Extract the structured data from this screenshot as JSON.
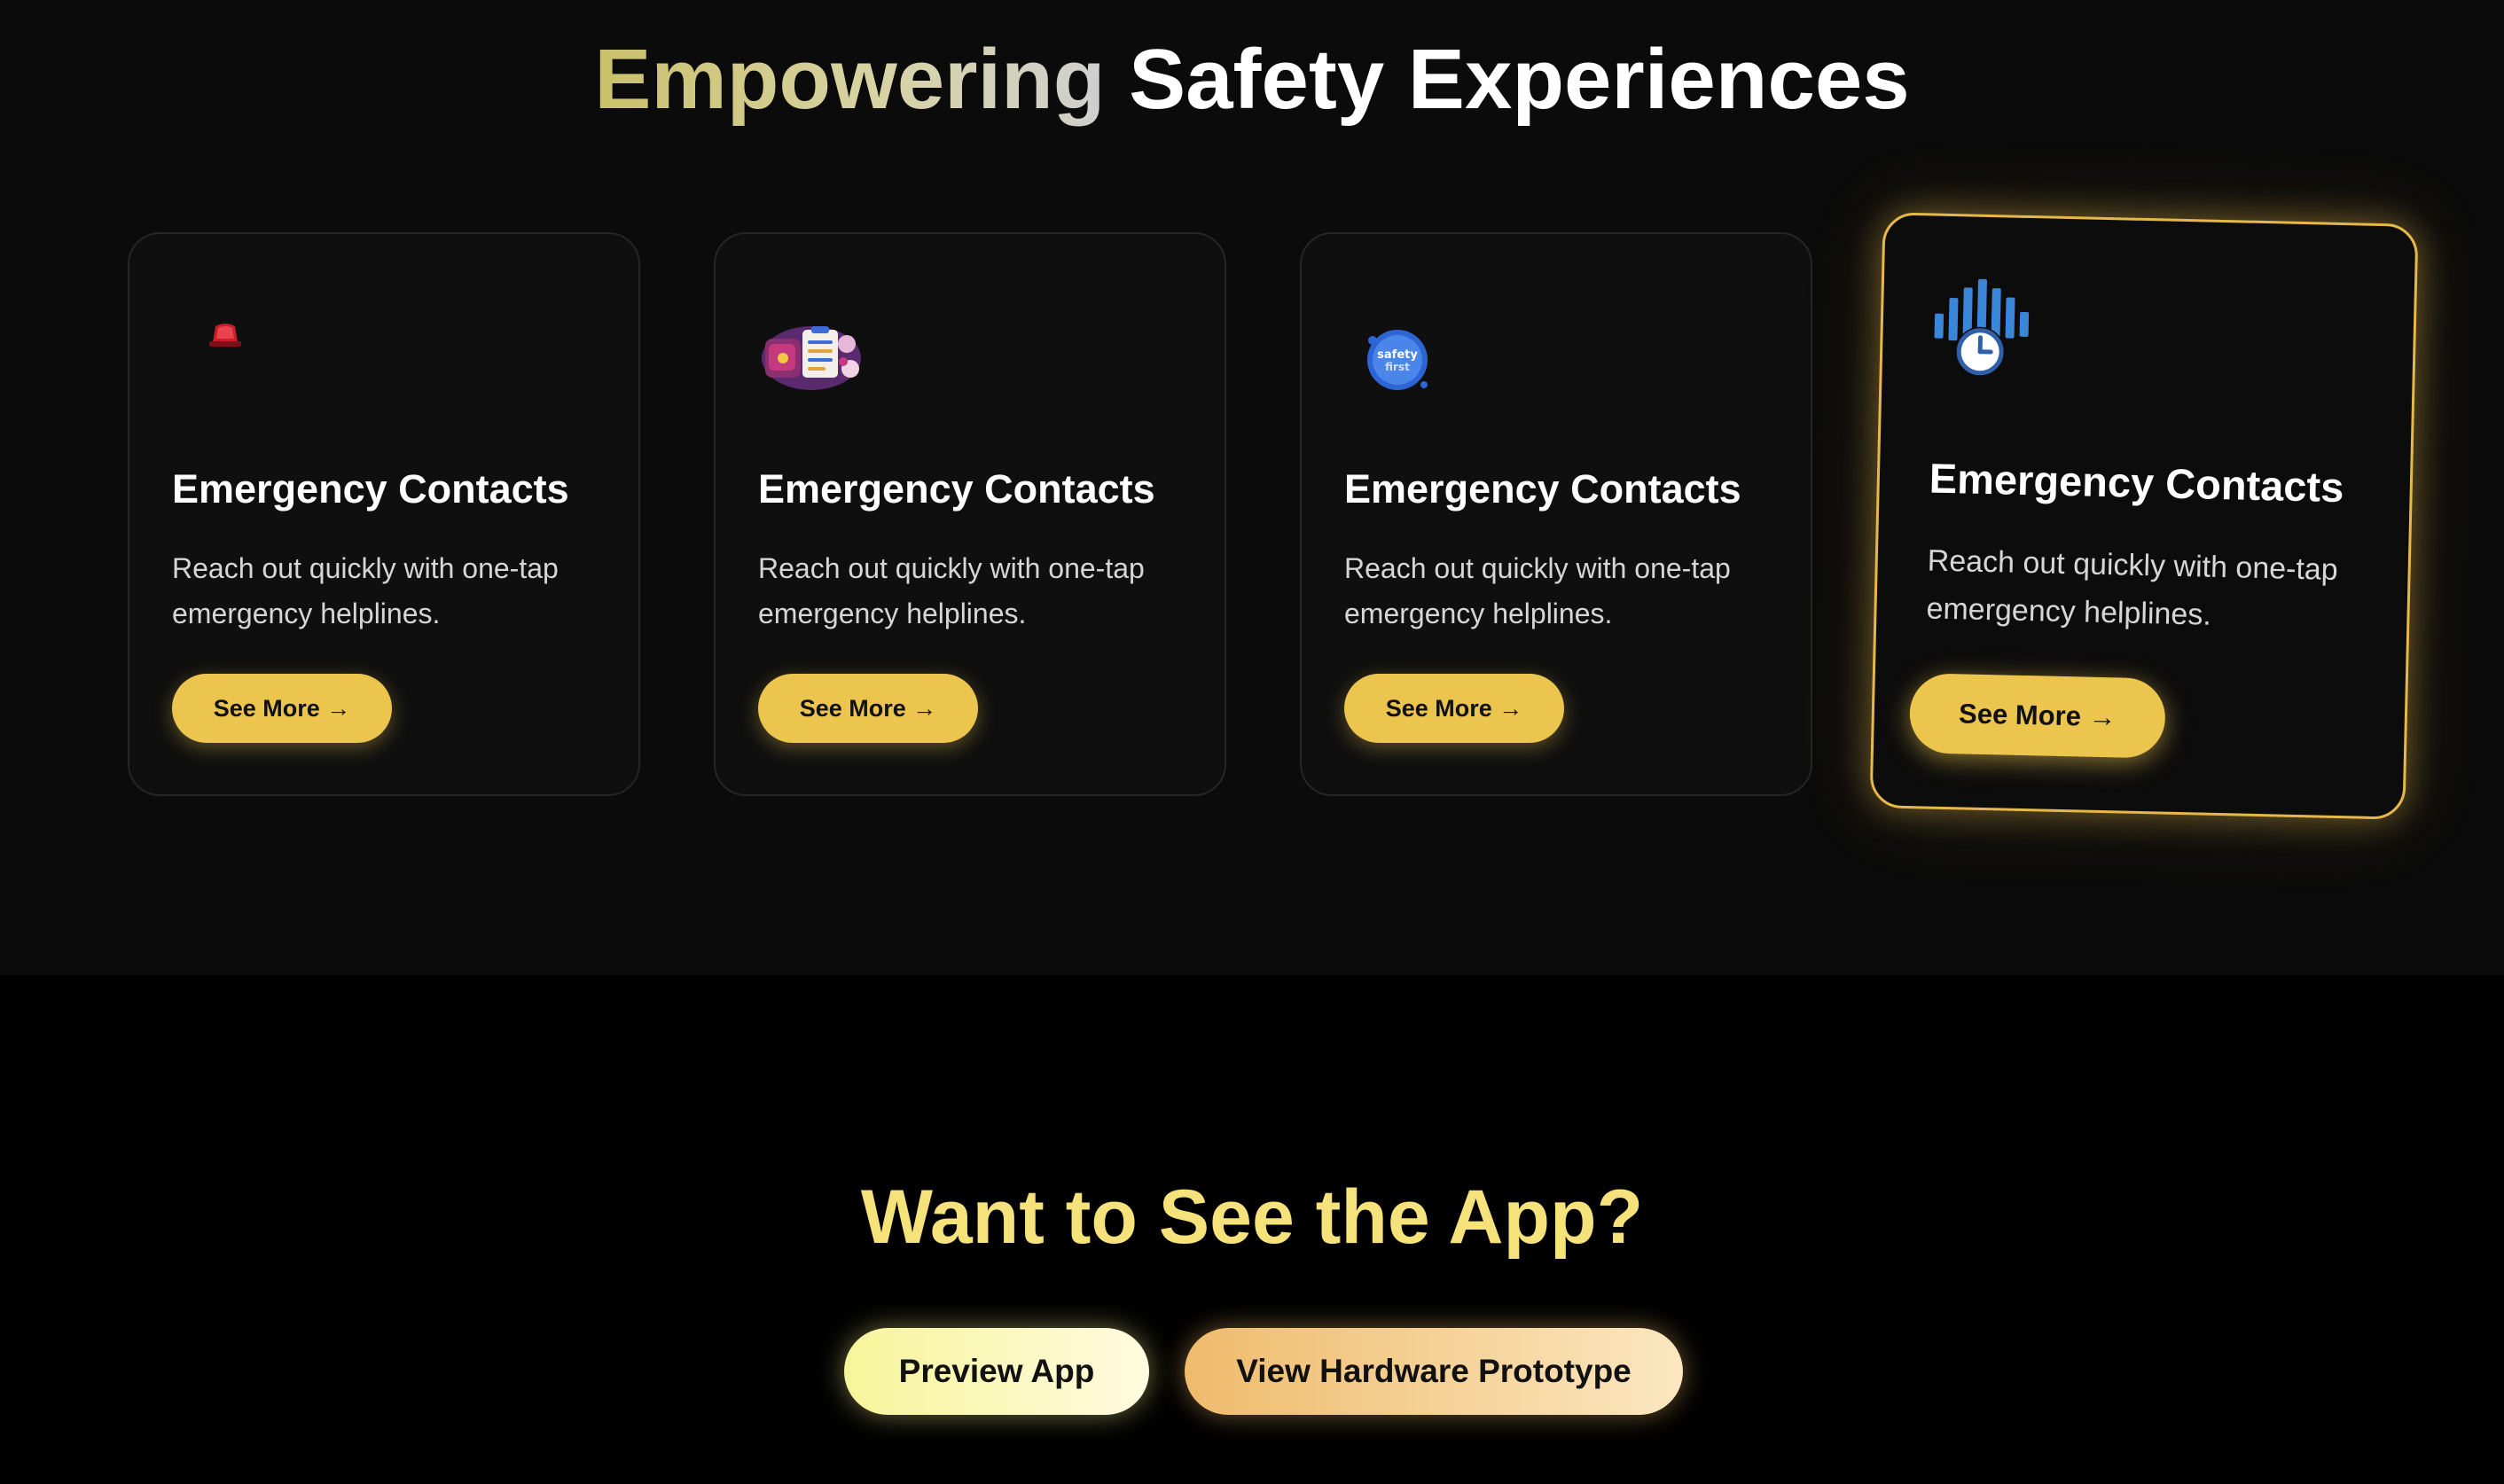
{
  "features": {
    "heading_accent": "Empowering",
    "heading_rest": " Safety Experiences",
    "cards": [
      {
        "icon": "siren-icon",
        "title": "Emergency Contacts",
        "description": "Reach out quickly with one-tap emergency helplines.",
        "button_label": "See More →"
      },
      {
        "icon": "safety-checklist-icon",
        "title": "Emergency Contacts",
        "description": "Reach out quickly with one-tap emergency helplines.",
        "button_label": "See More →"
      },
      {
        "icon": "safety-first-badge-icon",
        "title": "Emergency Contacts",
        "description": "Reach out quickly with one-tap emergency helplines.",
        "button_label": "See More →"
      },
      {
        "icon": "sound-clock-icon",
        "title": "Emergency Contacts",
        "description": "Reach out quickly with one-tap emergency helplines.",
        "button_label": "See More →",
        "highlighted": true
      }
    ]
  },
  "cta": {
    "title": "Want to See the App?",
    "preview_label": "Preview App",
    "hardware_label": "View Hardware Prototype"
  },
  "colors": {
    "background": "#000000",
    "section_background": "#0b0b0b",
    "accent_yellow": "#ecc54f",
    "cta_title": "#f5e27a",
    "highlight_border": "#e6b84a"
  }
}
